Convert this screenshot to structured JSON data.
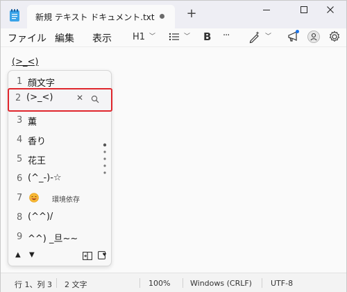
{
  "window": {
    "tab_title": "新規 テキスト ドキュメント.txt",
    "new_tab": "+"
  },
  "menu": {
    "file": "ファイル",
    "edit": "編集",
    "view": "表示"
  },
  "toolbar": {
    "heading": "H1",
    "bold": "B",
    "more": "···"
  },
  "editor": {
    "text": "(>_<)"
  },
  "candidates": [
    {
      "num": "1",
      "text": "顔文字"
    },
    {
      "num": "2",
      "text": "(>_<)"
    },
    {
      "num": "3",
      "text": "薫"
    },
    {
      "num": "4",
      "text": "香り"
    },
    {
      "num": "5",
      "text": "花王"
    },
    {
      "num": "6",
      "text": "(^_-)-☆"
    },
    {
      "num": "7",
      "text": "",
      "note": "環境依存"
    },
    {
      "num": "8",
      "text": "(^^)/"
    },
    {
      "num": "9",
      "text": "^^) _旦~~"
    }
  ],
  "candidate_actions": {
    "clear": "✕"
  },
  "popup_footer": {
    "up": "▲",
    "down": "▼"
  },
  "status": {
    "position": "行 1、列 3",
    "chars": "2 文字",
    "zoom": "100%",
    "line_ending": "Windows (CRLF)",
    "encoding": "UTF-8"
  },
  "colors": {
    "highlight_border": "#e0262c",
    "accent_dot": "#1a73e8"
  }
}
